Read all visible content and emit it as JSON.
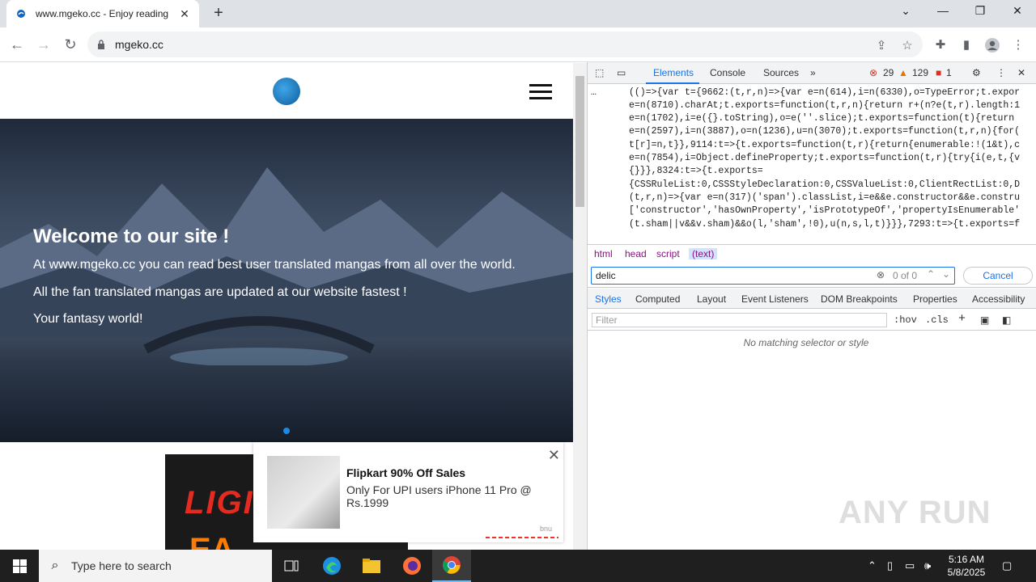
{
  "browser": {
    "tab_title": "www.mgeko.cc - Enjoy reading",
    "url": "mgeko.cc"
  },
  "site": {
    "hero_title": "Welcome to our site !",
    "hero_line1": "At www.mgeko.cc you can read best user translated mangas from all over the world.",
    "hero_line2": "All the fan translated mangas are updated at our website fastest !",
    "hero_line3": "Your fantasy world!",
    "banner_text": "LIGI",
    "banner_text2": "EA",
    "ad": {
      "title": "Flipkart 90% Off Sales",
      "body": "Only For UPI users iPhone 11 Pro @ Rs.1999",
      "brand": "bnu"
    }
  },
  "devtools": {
    "tabs": [
      "Elements",
      "Console",
      "Sources"
    ],
    "errors": "29",
    "warnings": "129",
    "issues": "1",
    "code_lines": [
      "(()=>{var t={9662:(t,r,n)=>{var e=n(614),i=n(6330),o=TypeError;t.expor",
      "e=n(8710).charAt;t.exports=function(t,r,n){return r+(n?e(t,r).length:1",
      "e=n(1702),i=e({}.toString),o=e(''.slice);t.exports=function(t){return",
      "e=n(2597),i=n(3887),o=n(1236),u=n(3070);t.exports=function(t,r,n){for(",
      "t[r]=n,t}},9114:t=>{t.exports=function(t,r){return{enumerable:!(1&t),c",
      "e=n(7854),i=Object.defineProperty;t.exports=function(t,r){try{i(e,t,{v",
      "{}}},8324:t=>{t.exports=",
      "{CSSRuleList:0,CSSStyleDeclaration:0,CSSValueList:0,ClientRectList:0,D",
      "(t,r,n)=>{var e=n(317)('span').classList,i=e&&e.constructor&&e.constru",
      "['constructor','hasOwnProperty','isPrototypeOf','propertyIsEnumerable'",
      "(t.sham||v&&v.sham)&&o(l,'sham',!0),u(n,s,l,t)}}},7293:t=>{t.exports=f"
    ],
    "crumbs": [
      "html",
      "head",
      "script",
      "(text)"
    ],
    "search_value": "delic",
    "search_count": "0 of 0",
    "cancel_label": "Cancel",
    "pane_tabs": [
      "Styles",
      "Computed",
      "Layout",
      "Event Listeners",
      "DOM Breakpoints",
      "Properties",
      "Accessibility"
    ],
    "filter_placeholder": "Filter",
    "hov": ":hov",
    "cls": ".cls",
    "no_match": "No matching selector or style"
  },
  "taskbar": {
    "search_placeholder": "Type here to search",
    "time": "5:16 AM",
    "date": "5/8/2025"
  },
  "watermark": "ANY RUN",
  "colors": {
    "accent": "#1a73e8",
    "error": "#d93025",
    "warning": "#e37400"
  }
}
